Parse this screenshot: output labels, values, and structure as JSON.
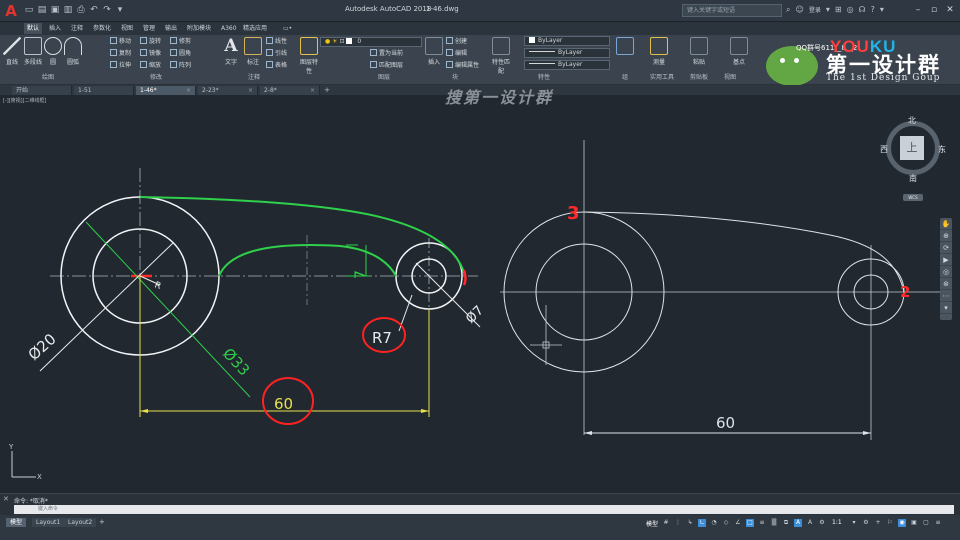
{
  "titlebar": {
    "title": "Autodesk AutoCAD 2018",
    "document": "1-46.dwg",
    "search_placeholder": "键入关键字或短语",
    "login_label": "登录"
  },
  "ribbon_tabs": [
    "默认",
    "插入",
    "注释",
    "参数化",
    "视图",
    "管理",
    "输出",
    "附加模块",
    "A360",
    "精选应用",
    "▭•"
  ],
  "ribbon": {
    "draw": {
      "title": "绘图",
      "line": "直线",
      "polyline": "多段线",
      "circle": "圆",
      "arc": "圆弧"
    },
    "modify": {
      "title": "修改",
      "move": "移动",
      "rotate": "旋转",
      "trim": "修剪",
      "copy": "复制",
      "mirror": "镜像",
      "fillet": "圆角",
      "stretch": "拉伸",
      "scale": "缩放",
      "array": "阵列"
    },
    "annotation": {
      "title": "注释",
      "text": "文字",
      "dimension": "标注",
      "linear": "线性",
      "leader": "引线",
      "table": "表格"
    },
    "layers": {
      "title": "图层",
      "layer_props": "图层特性",
      "current_layer": "0",
      "make_current": "置为当前",
      "match_layer": "匹配图层"
    },
    "block": {
      "title": "块",
      "insert": "插入",
      "create": "创建",
      "edit": "编辑",
      "edit_attr": "编辑属性"
    },
    "properties": {
      "title": "特性",
      "match": "特性匹配",
      "color": "ByLayer",
      "linetype": "ByLayer",
      "lineweight": "ByLayer"
    },
    "groups": {
      "title": "组"
    },
    "utilities": {
      "title": "实用工具",
      "measure": "测量"
    },
    "clipboard": {
      "title": "剪贴板",
      "paste": "粘贴"
    },
    "view": {
      "title": "视图",
      "base": "基点"
    }
  },
  "doc_tabs": [
    {
      "label": "开始",
      "active": false
    },
    {
      "label": "1-51",
      "active": false
    },
    {
      "label": "1-46*",
      "active": true
    },
    {
      "label": "2-23*",
      "active": false
    },
    {
      "label": "2-8*",
      "active": false
    }
  ],
  "viewport_label": "[-][俯视][二维线框]",
  "watermark_text": "搜第一设计群",
  "logo": {
    "youku_a": "YOU",
    "youku_b": "KU",
    "cn": "第一设计群",
    "en": "The 1st Design Goup",
    "qq": "QQ群号611__8__2"
  },
  "viewcube": {
    "north": "北",
    "south": "南",
    "east": "东",
    "west": "西",
    "top": "上",
    "wcs": "WCS"
  },
  "nav_icons": [
    "pan-icon",
    "zoom-icon",
    "orbit-icon",
    "showmotion-icon",
    "steering-icon",
    "fullnav-icon",
    "walk-icon",
    "down-icon"
  ],
  "drawing": {
    "left": {
      "dim_d20": "Ø20",
      "dim_d33": "Ø33",
      "dim_d7": "Ø7",
      "dim_r7": "R7",
      "dim_60": "60",
      "dim_7": "7",
      "dim_r_small": "R"
    },
    "right": {
      "dim_60": "60",
      "mark_3": "3",
      "mark_2": "2"
    }
  },
  "command": {
    "history": "命令: *取消*",
    "placeholder": "键入命令"
  },
  "status_tabs": [
    {
      "label": "模型",
      "active": true
    },
    {
      "label": "Layout1",
      "active": false
    },
    {
      "label": "Layout2",
      "active": false
    }
  ],
  "status": {
    "model": "模型",
    "scale": "1:1"
  }
}
